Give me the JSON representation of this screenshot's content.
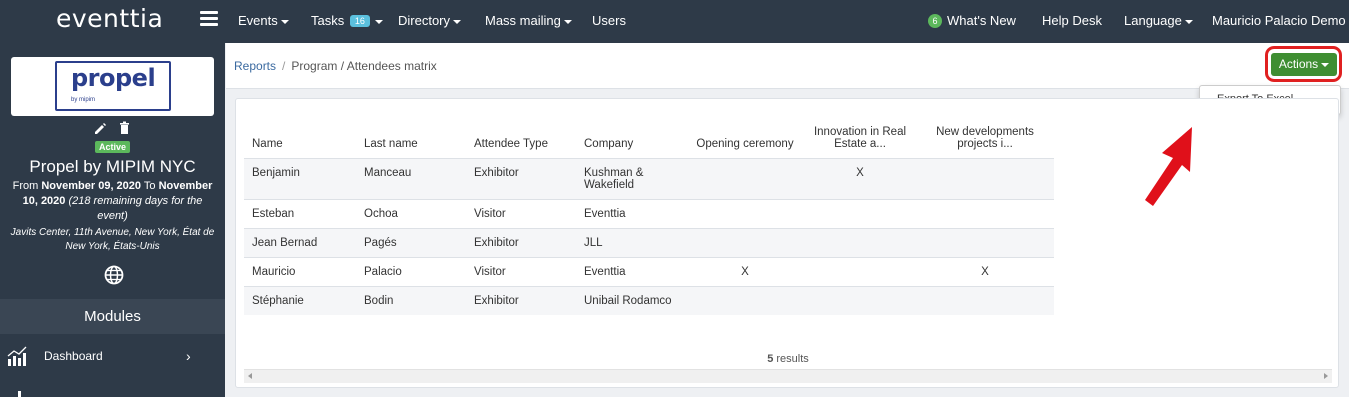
{
  "app": {
    "logo": "eventtia"
  },
  "topnav": {
    "events": "Events",
    "tasks": "Tasks",
    "tasks_badge": "16",
    "directory": "Directory",
    "mass_mailing": "Mass mailing",
    "users": "Users",
    "whats_new_badge": "6",
    "whats_new": "What's New",
    "help_desk": "Help Desk",
    "language": "Language",
    "user": "Mauricio Palacio Demo"
  },
  "sidebar": {
    "event_logo_text": "propel",
    "event_logo_sub": "by mipim",
    "status": "Active",
    "event_name": "Propel by MIPIM NYC",
    "dates_from_label": "From",
    "dates_from": "November 09, 2020",
    "dates_to_label": "To",
    "dates_to": "November 10, 2020",
    "dates_remaining": "(218 remaining days for the event)",
    "address": "Javits Center, 11th Avenue, New York, État de New York, États-Unis",
    "modules_header": "Modules",
    "dashboard_label": "Dashboard"
  },
  "breadcrumb": {
    "reports": "Reports",
    "current": "Program / Attendees matrix"
  },
  "actions": {
    "label": "Actions",
    "export_excel": "Export To Excel"
  },
  "table": {
    "headers": [
      "Name",
      "Last name",
      "Attendee Type",
      "Company",
      "Opening ceremony",
      "Innovation in Real Estate a...",
      "New developments projects i..."
    ],
    "rows": [
      [
        "Benjamin",
        "Manceau",
        "Exhibitor",
        "Kushman & Wakefield",
        "",
        "X",
        ""
      ],
      [
        "Esteban",
        "Ochoa",
        "Visitor",
        "Eventtia",
        "",
        "",
        ""
      ],
      [
        "Jean Bernad",
        "Pagés",
        "Exhibitor",
        "JLL",
        "",
        "",
        ""
      ],
      [
        "Mauricio",
        "Palacio",
        "Visitor",
        "Eventtia",
        "X",
        "",
        "X"
      ],
      [
        "Stéphanie",
        "Bodin",
        "Exhibitor",
        "Unibail Rodamco",
        "",
        "",
        ""
      ]
    ],
    "results_count": "5",
    "results_label": "results"
  },
  "colors": {
    "topbar": "#2e3a48",
    "actions_button": "#3f8e32",
    "highlight": "#e02020",
    "active_badge": "#5cb85c"
  }
}
